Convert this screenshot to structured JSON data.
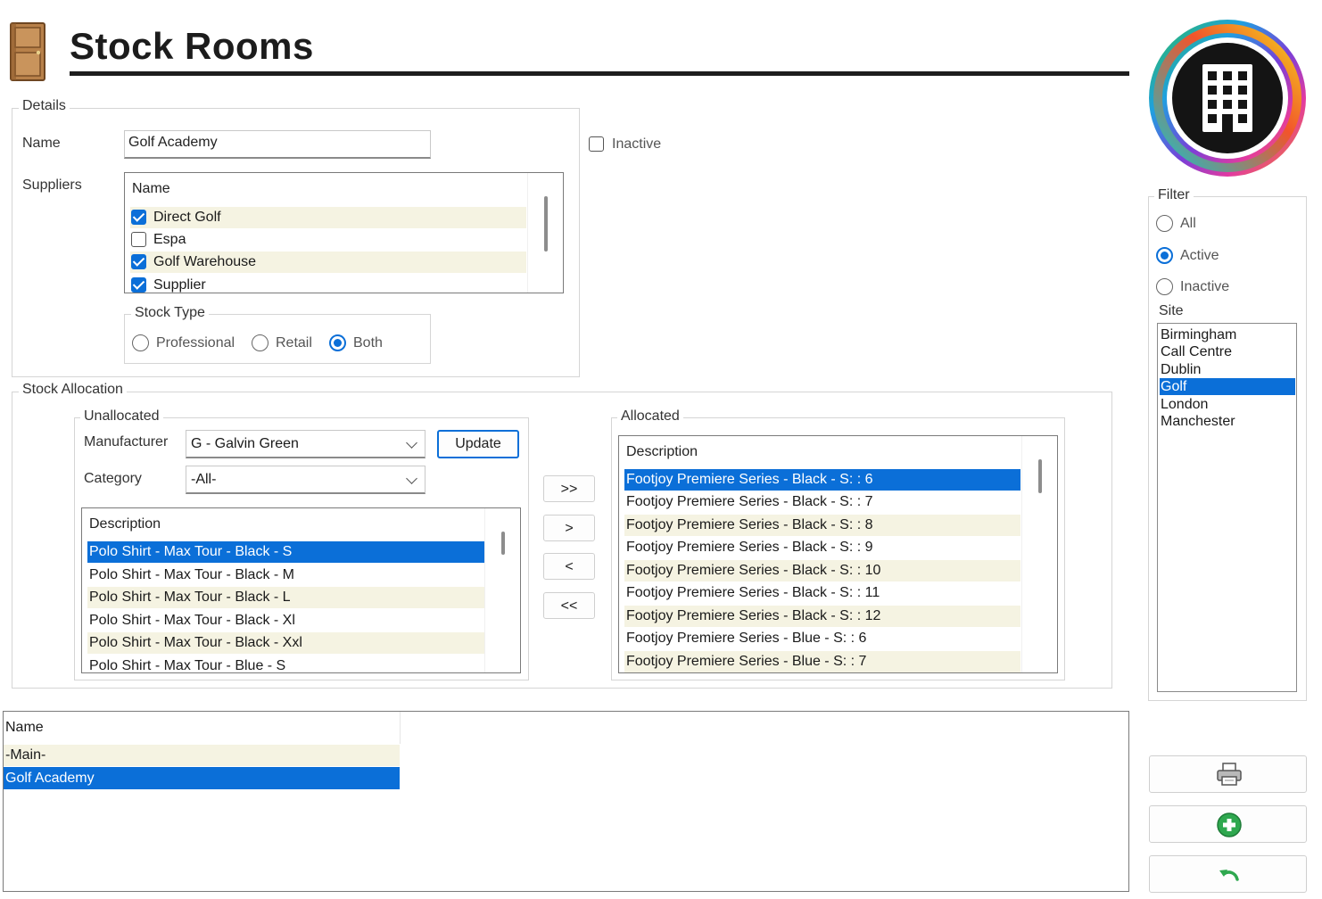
{
  "header": {
    "title": "Stock Rooms"
  },
  "details": {
    "legend": "Details",
    "name_label": "Name",
    "name_value": "Golf Academy",
    "inactive_label": "Inactive",
    "inactive_checked": false,
    "suppliers_label": "Suppliers",
    "suppliers": {
      "header": "Name",
      "items": [
        {
          "label": "Direct Golf",
          "checked": true
        },
        {
          "label": "Espa",
          "checked": false
        },
        {
          "label": "Golf Warehouse",
          "checked": true
        },
        {
          "label": "Supplier",
          "checked": true
        }
      ]
    },
    "stock_type": {
      "legend": "Stock Type",
      "options": [
        "Professional",
        "Retail",
        "Both"
      ],
      "selected": "Both"
    }
  },
  "allocation": {
    "legend": "Stock Allocation",
    "unallocated": {
      "legend": "Unallocated",
      "manufacturer_label": "Manufacturer",
      "manufacturer_value": "G - Galvin Green",
      "category_label": "Category",
      "category_value": "-All-",
      "update_label": "Update",
      "list_header": "Description",
      "items": [
        "Polo Shirt - Max Tour - Black - S",
        "Polo Shirt - Max Tour - Black - M",
        "Polo Shirt - Max Tour - Black - L",
        "Polo Shirt - Max Tour - Black - Xl",
        "Polo Shirt - Max Tour - Black - Xxl",
        "Polo Shirt - Max Tour - Blue - S"
      ]
    },
    "move_buttons": [
      ">>",
      ">",
      "<",
      "<<"
    ],
    "allocated": {
      "legend": "Allocated",
      "list_header": "Description",
      "items": [
        "Footjoy Premiere Series - Black - S: : 6",
        "Footjoy Premiere Series - Black - S: : 7",
        "Footjoy Premiere Series - Black - S: : 8",
        "Footjoy Premiere Series - Black - S: : 9",
        "Footjoy Premiere Series - Black - S: : 10",
        "Footjoy Premiere Series - Black - S: : 11",
        "Footjoy Premiere Series - Black - S: : 12",
        "Footjoy Premiere Series - Blue - S: : 6",
        "Footjoy Premiere Series - Blue - S: : 7"
      ]
    }
  },
  "filter": {
    "legend": "Filter",
    "options": [
      "All",
      "Active",
      "Inactive"
    ],
    "selected": "Active",
    "site_label": "Site",
    "sites": [
      "Birmingham",
      "Call Centre",
      "Dublin",
      "Golf",
      "London",
      "Manchester"
    ],
    "selected_site": "Golf"
  },
  "stock_rooms": {
    "header": "Name",
    "rows": [
      "-Main-",
      "Golf Academy"
    ],
    "selected": "Golf Academy"
  },
  "actions": {
    "icons": [
      "printer-icon",
      "add-icon",
      "undo-icon"
    ]
  },
  "colors": {
    "accent": "#0b6fd8",
    "row_alt": "#f5f3e2"
  }
}
